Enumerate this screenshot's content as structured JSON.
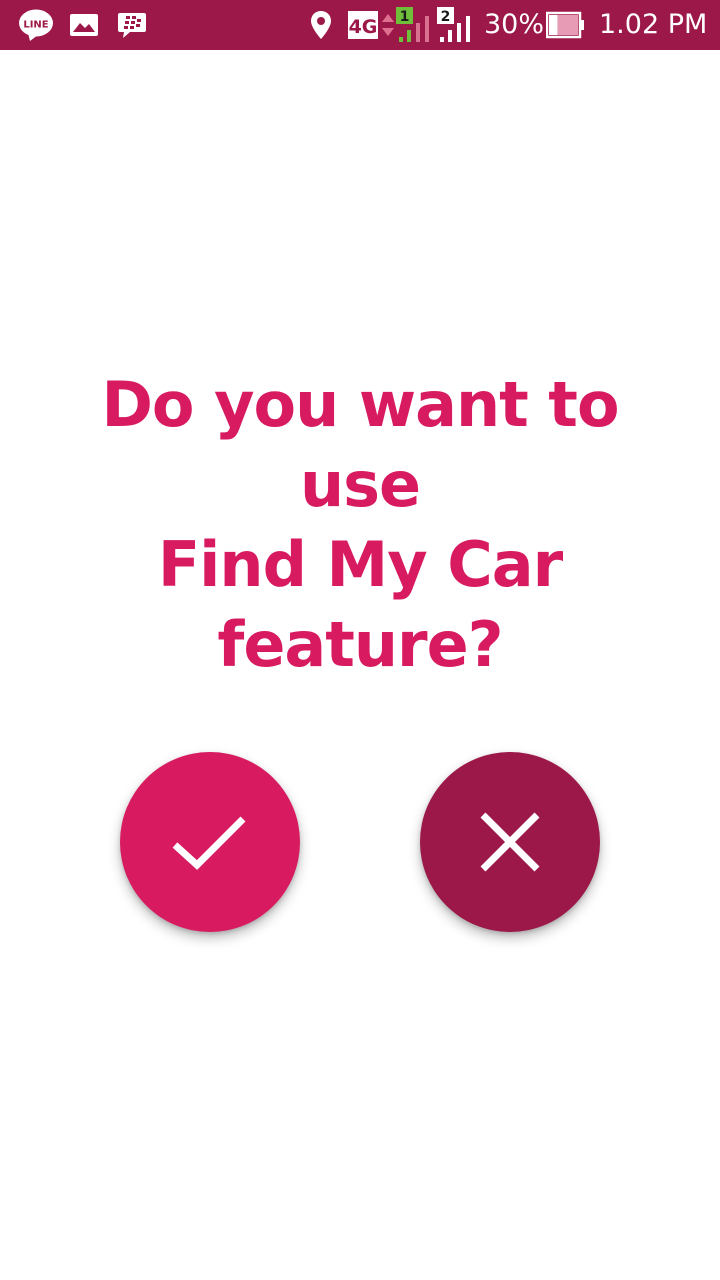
{
  "status_bar": {
    "background": "#9c1848",
    "left_icons": [
      "line-app-icon",
      "gallery-image-icon",
      "bbm-icon"
    ],
    "line_icon_text": "LINE",
    "right_icons": [
      "location-icon",
      "network-4g-icon",
      "sim1-signal-icon",
      "sim2-signal-icon",
      "battery-icon"
    ],
    "network_label": "4G",
    "sim1_label": "1",
    "sim2_label": "2",
    "battery_percent_text": "30%",
    "battery_level": 0.3,
    "time": "1.02 PM"
  },
  "dialog": {
    "question_lines": [
      "Do you want to use",
      "Find My Car",
      "feature?"
    ],
    "text_color": "#d81b60",
    "confirm_button": {
      "icon": "check-icon",
      "color": "#d81b60"
    },
    "cancel_button": {
      "icon": "close-icon",
      "color": "#9c1848"
    }
  }
}
